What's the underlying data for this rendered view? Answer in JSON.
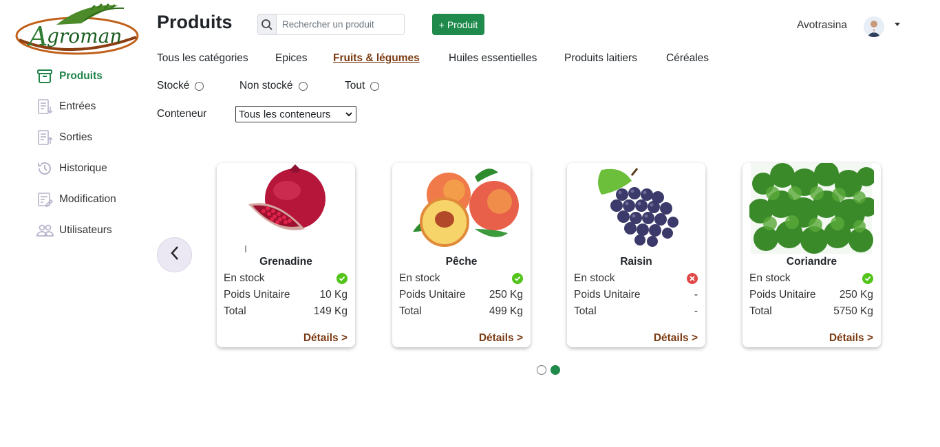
{
  "brand": {
    "name": "Agroman",
    "color": "#1f8a4c",
    "accent": "#7b3a12"
  },
  "sidebar": {
    "items": [
      {
        "label": "Produits",
        "icon": "archive-box-icon",
        "active": true
      },
      {
        "label": "Entrées",
        "icon": "list-in-icon"
      },
      {
        "label": "Sorties",
        "icon": "list-out-icon"
      },
      {
        "label": "Historique",
        "icon": "history-icon"
      },
      {
        "label": "Modification",
        "icon": "edit-list-icon"
      },
      {
        "label": "Utilisateurs",
        "icon": "users-icon"
      }
    ]
  },
  "header": {
    "title": "Produits",
    "search_placeholder": "Rechercher un produit",
    "add_label": "+ Produit",
    "user_name": "Avotrasina"
  },
  "tabs": [
    {
      "label": "Tous les catégories"
    },
    {
      "label": "Epices"
    },
    {
      "label": "Fruits & légumes",
      "active": true
    },
    {
      "label": "Huiles essentielles"
    },
    {
      "label": "Produits laitiers"
    },
    {
      "label": "Céréales"
    }
  ],
  "filters": {
    "stock_options": [
      "Stocké",
      "Non stocké",
      "Tout"
    ],
    "container_label": "Conteneur",
    "container_selected": "Tous les conteneurs"
  },
  "products": [
    {
      "name": "Grenadine",
      "stock_label": "En stock",
      "in_stock": true,
      "weight_label": "Poids Unitaire",
      "weight": "10 Kg",
      "total_label": "Total",
      "total": "149 Kg",
      "details": "Détails >"
    },
    {
      "name": "Pêche",
      "stock_label": "En stock",
      "in_stock": true,
      "weight_label": "Poids Unitaire",
      "weight": "250 Kg",
      "total_label": "Total",
      "total": "499 Kg",
      "details": "Détails >"
    },
    {
      "name": "Raisin",
      "stock_label": "En stock",
      "in_stock": false,
      "weight_label": "Poids Unitaire",
      "weight": "-",
      "total_label": "Total",
      "total": "-",
      "details": "Détails >"
    },
    {
      "name": "Coriandre",
      "stock_label": "En stock",
      "in_stock": true,
      "weight_label": "Poids Unitaire",
      "weight": "250 Kg",
      "total_label": "Total",
      "total": "5750 Kg",
      "details": "Détails >"
    }
  ],
  "carousel": {
    "pages": 2,
    "current_page": 2
  }
}
